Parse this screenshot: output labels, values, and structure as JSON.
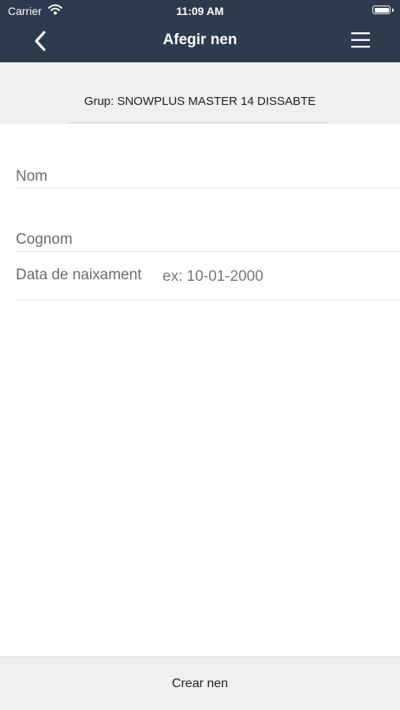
{
  "status_bar": {
    "carrier": "Carrier",
    "time": "11:09 AM",
    "wifi_icon": "wifi-icon",
    "battery_icon": "battery-icon"
  },
  "navbar": {
    "title": "Afegir nen",
    "back_icon": "chevron-left-icon",
    "menu_icon": "hamburger-menu-icon",
    "background_color": "#2d3b4e"
  },
  "group": {
    "text": "Grup: SNOWPLUS MASTER 14 DISSABTE"
  },
  "form": {
    "nom_label": "Nom",
    "cognom_label": "Cognom",
    "birthdate_label": "Data de naixament",
    "birthdate_placeholder": "ex: 10-01-2000"
  },
  "footer": {
    "create_label": "Crear nen"
  }
}
